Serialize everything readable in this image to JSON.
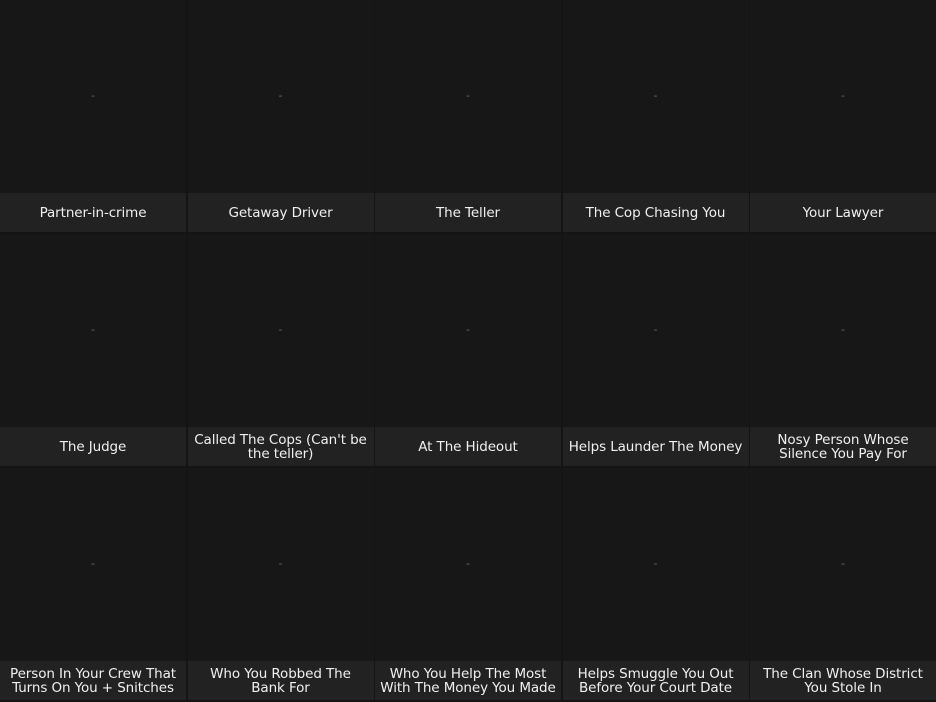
{
  "placeholder_glyph": "-",
  "cards": [
    {
      "label": "Partner-in-crime"
    },
    {
      "label": "Getaway Driver"
    },
    {
      "label": "The Teller"
    },
    {
      "label": "The Cop Chasing You"
    },
    {
      "label": "Your Lawyer"
    },
    {
      "label": "The Judge"
    },
    {
      "label": "Called The Cops (Can't be the teller)"
    },
    {
      "label": "At The Hideout"
    },
    {
      "label": "Helps Launder The Money"
    },
    {
      "label": "Nosy Person Whose Silence You Pay For"
    },
    {
      "label": "Person In Your Crew That Turns On You + Snitches"
    },
    {
      "label": "Who You Robbed The Bank For"
    },
    {
      "label": "Who You Help The Most With The Money You Made"
    },
    {
      "label": "Helps Smuggle You Out Before Your Court Date"
    },
    {
      "label": "The Clan Whose District You Stole In"
    }
  ]
}
